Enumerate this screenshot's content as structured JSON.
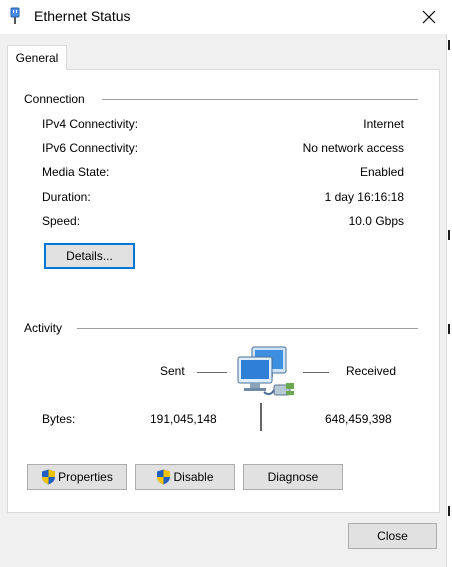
{
  "window": {
    "title": "Ethernet Status",
    "icon": "ethernet-icon"
  },
  "tabs": [
    {
      "label": "General",
      "active": true
    }
  ],
  "connection": {
    "group_label": "Connection",
    "rows": [
      {
        "label": "IPv4 Connectivity:",
        "value": "Internet"
      },
      {
        "label": "IPv6 Connectivity:",
        "value": "No network access"
      },
      {
        "label": "Media State:",
        "value": "Enabled"
      },
      {
        "label": "Duration:",
        "value": "1 day 16:16:18"
      },
      {
        "label": "Speed:",
        "value": "10.0 Gbps"
      }
    ],
    "details_button": "Details..."
  },
  "activity": {
    "group_label": "Activity",
    "sent_label": "Sent",
    "received_label": "Received",
    "bytes_label": "Bytes:",
    "bytes_sent": "191,045,148",
    "bytes_received": "648,459,398",
    "icon": "network-computers-icon"
  },
  "buttons": {
    "properties": "Properties",
    "disable": "Disable",
    "diagnose": "Diagnose",
    "close": "Close"
  },
  "colors": {
    "accent": "#0078d7",
    "shield_blue": "#1f5fbf",
    "shield_yellow": "#f2c200"
  }
}
